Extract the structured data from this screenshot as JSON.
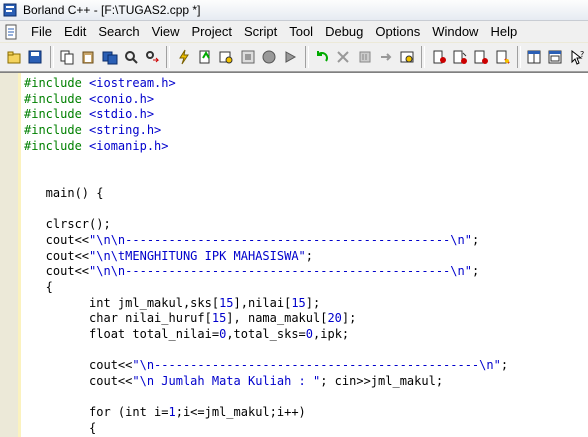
{
  "window": {
    "title": "Borland C++ - [F:\\TUGAS2.cpp *]"
  },
  "menu": {
    "items": [
      {
        "name": "menu-file",
        "label": "File"
      },
      {
        "name": "menu-edit",
        "label": "Edit"
      },
      {
        "name": "menu-search",
        "label": "Search"
      },
      {
        "name": "menu-view",
        "label": "View"
      },
      {
        "name": "menu-project",
        "label": "Project"
      },
      {
        "name": "menu-script",
        "label": "Script"
      },
      {
        "name": "menu-tool",
        "label": "Tool"
      },
      {
        "name": "menu-debug",
        "label": "Debug"
      },
      {
        "name": "menu-options",
        "label": "Options"
      },
      {
        "name": "menu-window",
        "label": "Window"
      },
      {
        "name": "menu-help",
        "label": "Help"
      }
    ]
  },
  "toolbar": {
    "groups": [
      [
        "open-icon",
        "save-icon"
      ],
      [
        "copy-file-icon",
        "paste-file-icon",
        "save-all-icon",
        "find-icon",
        "replace-icon"
      ],
      [
        "lightning-icon",
        "compile-icon",
        "make-icon",
        "build-icon",
        "stop-icon",
        "run-icon"
      ],
      [
        "undo-icon",
        "close-file-icon",
        "step-icon",
        "trace-icon",
        "inspect-icon"
      ],
      [
        "breakpoint-icon",
        "toggle-breakpoint-icon",
        "watch-icon",
        "evaluate-icon"
      ],
      [
        "tile-window-icon",
        "cascade-window-icon",
        "help-cursor-icon"
      ]
    ]
  },
  "editor": {
    "lines": [
      [
        {
          "t": "#include ",
          "c": "kw-inc"
        },
        {
          "t": "<iostream.h>",
          "c": "inc-file"
        }
      ],
      [
        {
          "t": "#include ",
          "c": "kw-inc"
        },
        {
          "t": "<conio.h>",
          "c": "inc-file"
        }
      ],
      [
        {
          "t": "#include ",
          "c": "kw-inc"
        },
        {
          "t": "<stdio.h>",
          "c": "inc-file"
        }
      ],
      [
        {
          "t": "#include ",
          "c": "kw-inc"
        },
        {
          "t": "<string.h>",
          "c": "inc-file"
        }
      ],
      [
        {
          "t": "#include ",
          "c": "kw-inc"
        },
        {
          "t": "<iomanip.h>",
          "c": "inc-file"
        }
      ],
      [
        {
          "t": "",
          "c": ""
        }
      ],
      [
        {
          "t": "",
          "c": ""
        }
      ],
      [
        {
          "t": "   main() {",
          "c": ""
        }
      ],
      [
        {
          "t": "",
          "c": ""
        }
      ],
      [
        {
          "t": "   clrscr();",
          "c": ""
        }
      ],
      [
        {
          "t": "   cout<<",
          "c": ""
        },
        {
          "t": "\"\\n\\n---------------------------------------------\\n\"",
          "c": "str"
        },
        {
          "t": ";",
          "c": ""
        }
      ],
      [
        {
          "t": "   cout<<",
          "c": ""
        },
        {
          "t": "\"\\n\\tMENGHITUNG IPK MAHASISWA\"",
          "c": "str"
        },
        {
          "t": ";",
          "c": ""
        }
      ],
      [
        {
          "t": "   cout<<",
          "c": ""
        },
        {
          "t": "\"\\n\\n---------------------------------------------\\n\"",
          "c": "str"
        },
        {
          "t": ";",
          "c": ""
        }
      ],
      [
        {
          "t": "   {",
          "c": ""
        }
      ],
      [
        {
          "t": "         int jml_makul,sks[",
          "c": ""
        },
        {
          "t": "15",
          "c": "num"
        },
        {
          "t": "],nilai[",
          "c": ""
        },
        {
          "t": "15",
          "c": "num"
        },
        {
          "t": "];",
          "c": ""
        }
      ],
      [
        {
          "t": "         char nilai_huruf[",
          "c": ""
        },
        {
          "t": "15",
          "c": "num"
        },
        {
          "t": "], nama_makul[",
          "c": ""
        },
        {
          "t": "20",
          "c": "num"
        },
        {
          "t": "];",
          "c": ""
        }
      ],
      [
        {
          "t": "         float total_nilai=",
          "c": ""
        },
        {
          "t": "0",
          "c": "num"
        },
        {
          "t": ",total_sks=",
          "c": ""
        },
        {
          "t": "0",
          "c": "num"
        },
        {
          "t": ",ipk;",
          "c": ""
        }
      ],
      [
        {
          "t": "",
          "c": ""
        }
      ],
      [
        {
          "t": "         cout<<",
          "c": ""
        },
        {
          "t": "\"\\n---------------------------------------------\\n\"",
          "c": "str"
        },
        {
          "t": ";",
          "c": ""
        }
      ],
      [
        {
          "t": "         cout<<",
          "c": ""
        },
        {
          "t": "\"\\n Jumlah Mata Kuliah : \"",
          "c": "str"
        },
        {
          "t": "; cin>>jml_makul;",
          "c": ""
        }
      ],
      [
        {
          "t": "",
          "c": ""
        }
      ],
      [
        {
          "t": "         for (int i=",
          "c": ""
        },
        {
          "t": "1",
          "c": "num"
        },
        {
          "t": ";i<=jml_makul;i++)",
          "c": ""
        }
      ],
      [
        {
          "t": "         {",
          "c": ""
        }
      ]
    ]
  }
}
